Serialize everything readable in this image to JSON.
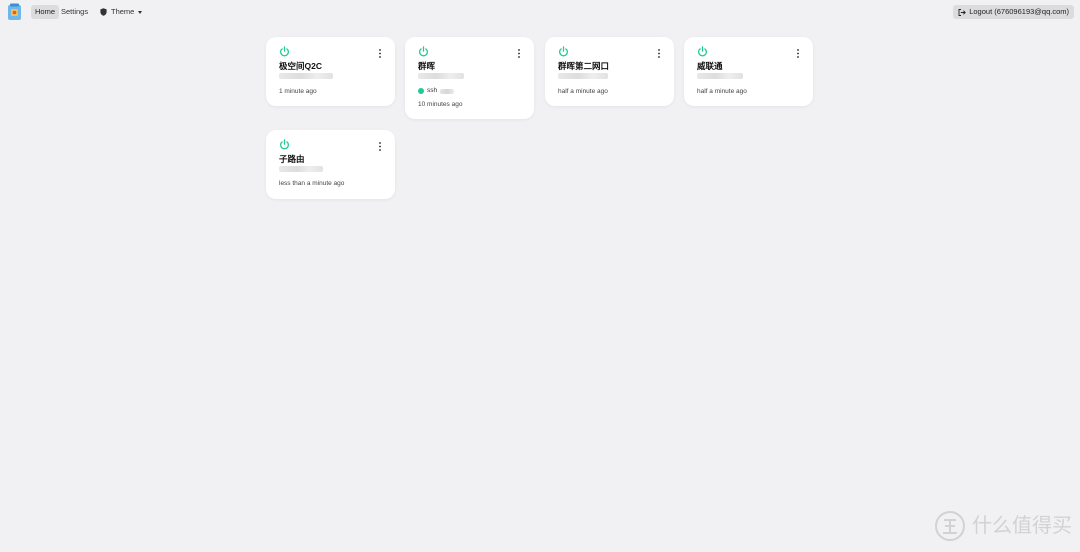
{
  "nav": {
    "home_label": "Home",
    "settings_label": "Settings",
    "theme_label": "Theme",
    "logout_label": "Logout (676096193@qq.com)"
  },
  "colors": {
    "accent_green": "#20c997",
    "background": "#f1f1f3",
    "card": "#ffffff",
    "nav_active": "#dcdcdf"
  },
  "cards": [
    {
      "name": "极空间Q2C",
      "time": "1 minute ago",
      "status_icon": "power-icon"
    },
    {
      "name": "群晖",
      "time": "10 minutes ago",
      "status_icon": "power-icon",
      "service": {
        "label": "ssh",
        "status_color": "#20c997"
      }
    },
    {
      "name": "群晖第二网口",
      "time": "half a minute ago",
      "status_icon": "power-icon"
    },
    {
      "name": "威联通",
      "time": "half a minute ago",
      "status_icon": "power-icon"
    },
    {
      "name": "子路由",
      "time": "less than a minute ago",
      "status_icon": "power-icon"
    }
  ],
  "watermark": {
    "text": "什么值得买",
    "icon": "zhi-logo-icon"
  }
}
